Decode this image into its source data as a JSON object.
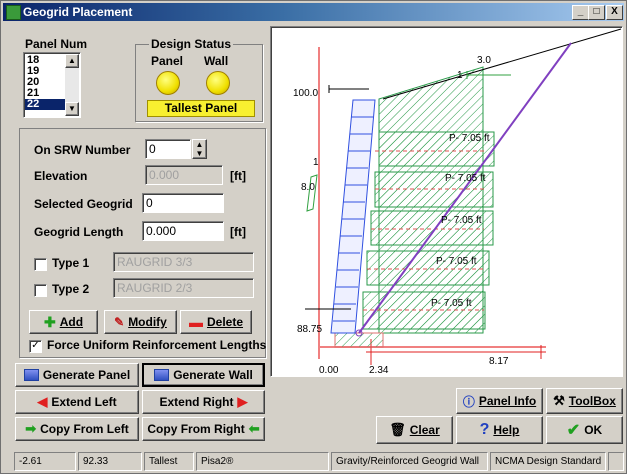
{
  "window": {
    "title": "Geogrid Placement"
  },
  "titlebar_buttons": {
    "minimize": "_",
    "maximize": "□",
    "close": "X"
  },
  "panel_num": {
    "label": "Panel Num",
    "items": [
      "18",
      "19",
      "20",
      "21",
      "22"
    ],
    "selected_index": 4
  },
  "design_status": {
    "label": "Design Status",
    "panel_label": "Panel",
    "wall_label": "Wall",
    "badge": "Tallest Panel"
  },
  "form": {
    "srw_label": "On SRW Number",
    "srw_value": "0",
    "elevation_label": "Elevation",
    "elevation_value": "0.000",
    "elevation_unit": "[ft]",
    "selected_label": "Selected Geogrid",
    "selected_value": "0",
    "length_label": "Geogrid Length",
    "length_value": "0.000",
    "length_unit": "[ft]",
    "type1_label": "Type 1",
    "type1_value": "RAUGRID 3/3",
    "type2_label": "Type 2",
    "type2_value": "RAUGRID 2/3",
    "add": "Add",
    "modify": "Modify",
    "delete": "Delete",
    "force_label": "Force Uniform Reinforcement Lengths",
    "force_checked": true
  },
  "buttons": {
    "generate_panel": "Generate Panel",
    "generate_wall": "Generate Wall",
    "extend_left": "Extend Left",
    "extend_right": "Extend Right",
    "copy_left": "Copy From Left",
    "copy_right": "Copy From Right",
    "panel_info": "Panel Info",
    "toolbox": "ToolBox",
    "clear": "Clear",
    "help": "Help",
    "ok": "OK"
  },
  "diagram": {
    "labels": {
      "top_right": "3.0",
      "left_top": "100.0",
      "left_mid_1": "1",
      "left_mid_2": "8.0",
      "bottom_left": "88.75",
      "origin_x": "0.00",
      "x_mark": "2.34",
      "x_right": "8.17",
      "small_one": "1"
    },
    "grid_labels": [
      "P-  7.05 ft",
      "P-  7.05 ft",
      "P-  7.05 ft",
      "P-  7.05 ft",
      "P-  7.05 ft"
    ],
    "colors": {
      "wall": "#3050e0",
      "grid": "#2a9a4a",
      "red": "#e02020",
      "slip": "#8040c0"
    }
  },
  "status_bar": [
    "-2.61",
    "92.33",
    "Tallest",
    "Pisa2®",
    "Gravity/Reinforced Geogrid Wall",
    "NCMA Design Standard",
    ""
  ]
}
